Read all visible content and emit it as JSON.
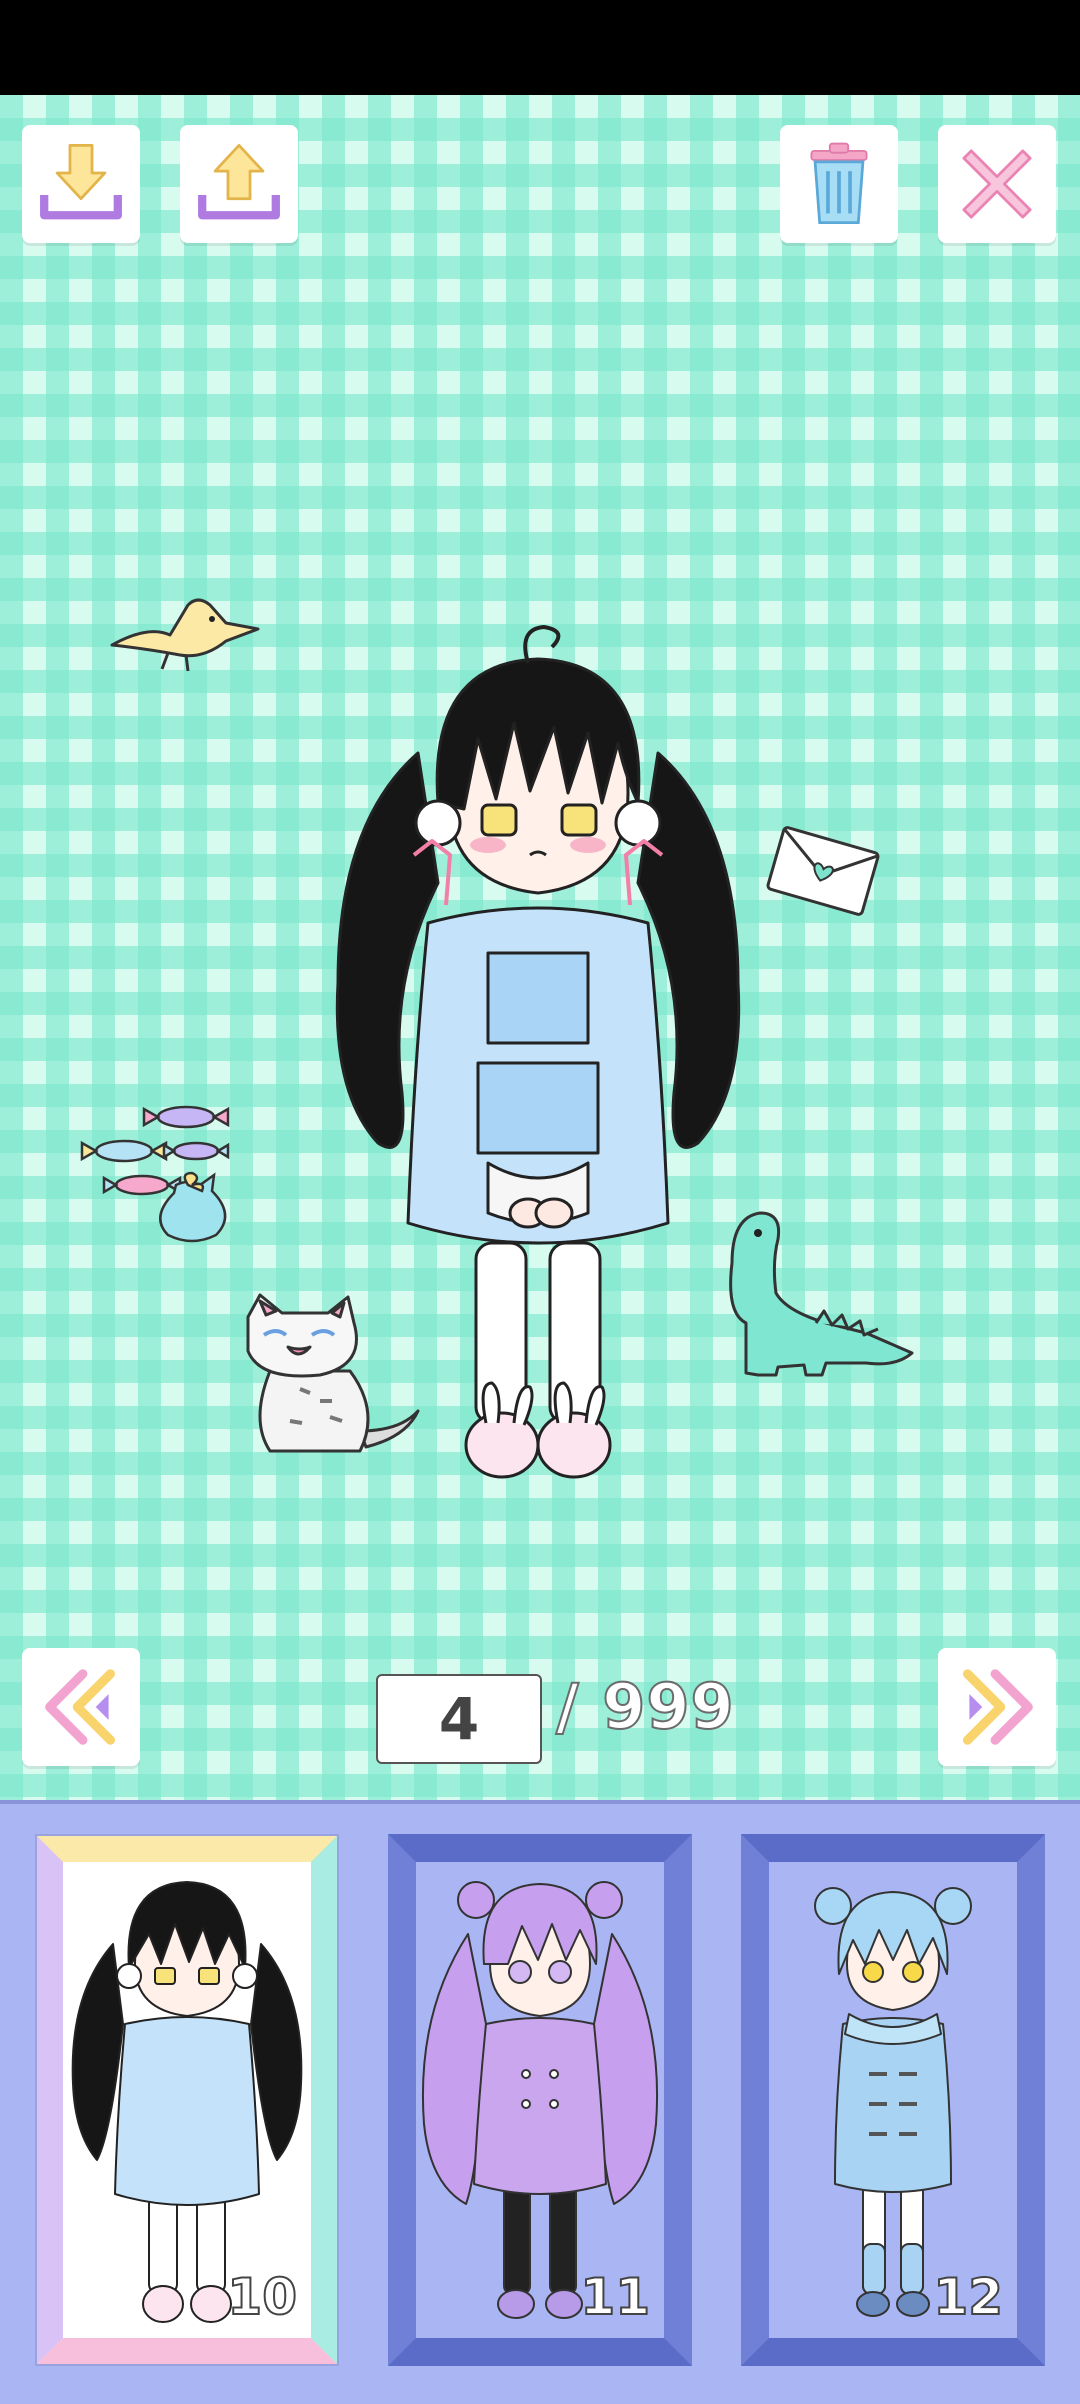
{
  "toolbar": {
    "import_icon": "download-tray-icon",
    "export_icon": "upload-tray-icon",
    "delete_icon": "trash-icon",
    "close_icon": "close-x-icon"
  },
  "pager": {
    "current_page": "4",
    "total_pages": "/ 999",
    "prev_icon": "double-chevron-left-icon",
    "next_icon": "double-chevron-right-icon"
  },
  "slots": [
    {
      "number": "10",
      "selected": true,
      "hair_color": "#151515",
      "outfit_color": "#bfe0fb"
    },
    {
      "number": "11",
      "selected": false,
      "hair_color": "#c6a0ef",
      "outfit_color": "#c9a6ee"
    },
    {
      "number": "12",
      "selected": false,
      "hair_color": "#a8d6f5",
      "outfit_color": "#a9d3f3"
    }
  ],
  "colors": {
    "stage_check": "#7ee8cd",
    "panel_bg": "#aab6f4",
    "slot_frame": "#5a6cc8"
  }
}
